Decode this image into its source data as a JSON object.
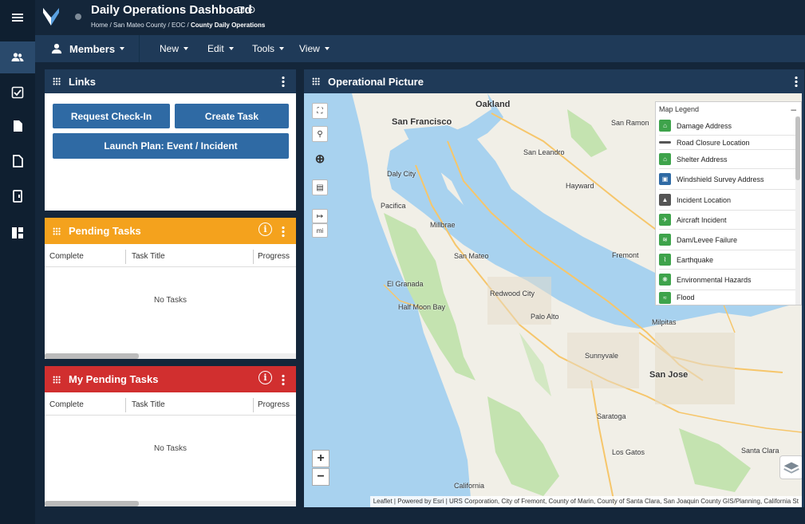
{
  "header": {
    "title": "Daily Operations Dashboard",
    "title_icons": "⊡ ⊙",
    "breadcrumb": [
      "Home",
      "San Mateo County",
      "EOC",
      "County Daily Operations"
    ]
  },
  "toolbar": {
    "members": "Members",
    "menus": [
      "New",
      "Edit",
      "Tools",
      "View"
    ]
  },
  "rail": {
    "icons": [
      "menu-icon",
      "members-icon",
      "tasks-icon",
      "documents-icon",
      "forms-icon",
      "plans-icon",
      "dashboards-icon"
    ]
  },
  "links_panel": {
    "title": "Links",
    "color": "#1f3a58",
    "buttons": [
      "Request Check-In",
      "Create Task",
      "Launch Plan: Event / Incident"
    ]
  },
  "pending_tasks": {
    "title": "Pending Tasks",
    "color": "#f4a21d",
    "columns": [
      "Complete",
      "Task Title",
      "Progress"
    ],
    "empty": "No Tasks"
  },
  "my_pending_tasks": {
    "title": "My Pending Tasks",
    "color": "#d12f2f",
    "columns": [
      "Complete",
      "Task Title",
      "Progress"
    ],
    "empty": "No Tasks"
  },
  "map_panel": {
    "title": "Operational Picture",
    "scale_unit": "mi",
    "cities": [
      "Oakland",
      "San Francisco",
      "San Ramon",
      "San Leandro",
      "Daly City",
      "Hayward",
      "Pacifica",
      "Millbrae",
      "San Mateo",
      "Fremont",
      "El Granada",
      "Redwood City",
      "Half Moon Bay",
      "Palo Alto",
      "Milpitas",
      "Sunnyvale",
      "San Jose",
      "Saratoga",
      "Los Gatos",
      "Santa Clara",
      "California"
    ],
    "legend": {
      "title": "Map Legend",
      "minimize": "–",
      "items": [
        "Damage Address",
        "Road Closure Location",
        "Shelter Address",
        "Windshield Survey Address",
        "Incident Location",
        "Aircraft Incident",
        "Dam/Levee Failure",
        "Earthquake",
        "Environmental Hazards",
        "Flood"
      ]
    },
    "attribution": "Leaflet | Powered by Esri | URS Corporation, City of Fremont, County of Marin, County of Santa Clara, San Joaquin County GIS/Planning, California St"
  },
  "colors": {
    "accent": "#2f6aa4",
    "nav": "#1f3a58",
    "background": "#14263a"
  }
}
